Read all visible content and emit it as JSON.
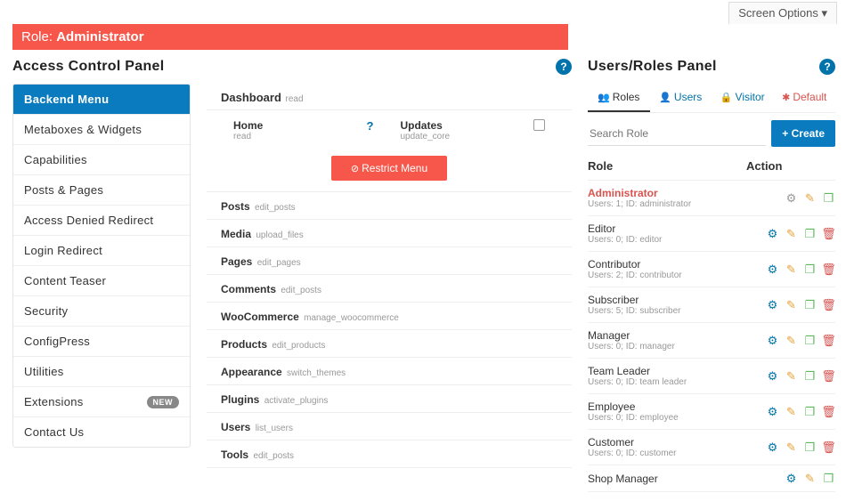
{
  "screen_options": "Screen Options ▾",
  "banner": {
    "prefix": "Role:",
    "role": "Administrator"
  },
  "left_panel_title": "Access Control Panel",
  "right_panel_title": "Users/Roles Panel",
  "sidebar": {
    "items": [
      {
        "label": "Backend Menu",
        "active": true
      },
      {
        "label": "Metaboxes & Widgets"
      },
      {
        "label": "Capabilities"
      },
      {
        "label": "Posts & Pages"
      },
      {
        "label": "Access Denied Redirect"
      },
      {
        "label": "Login Redirect"
      },
      {
        "label": "Content Teaser"
      },
      {
        "label": "Security"
      },
      {
        "label": "ConfigPress"
      },
      {
        "label": "Utilities"
      },
      {
        "label": "Extensions",
        "badge": "NEW"
      },
      {
        "label": "Contact Us"
      }
    ]
  },
  "dashboard": {
    "title": "Dashboard",
    "cap": "read",
    "home": {
      "label": "Home",
      "cap": "read"
    },
    "updates": {
      "label": "Updates",
      "cap": "update_core"
    },
    "restrict_label": "Restrict Menu"
  },
  "menu_caps": [
    {
      "title": "Posts",
      "cap": "edit_posts"
    },
    {
      "title": "Media",
      "cap": "upload_files"
    },
    {
      "title": "Pages",
      "cap": "edit_pages"
    },
    {
      "title": "Comments",
      "cap": "edit_posts"
    },
    {
      "title": "WooCommerce",
      "cap": "manage_woocommerce"
    },
    {
      "title": "Products",
      "cap": "edit_products"
    },
    {
      "title": "Appearance",
      "cap": "switch_themes"
    },
    {
      "title": "Plugins",
      "cap": "activate_plugins"
    },
    {
      "title": "Users",
      "cap": "list_users"
    },
    {
      "title": "Tools",
      "cap": "edit_posts"
    }
  ],
  "tabs": {
    "roles": "Roles",
    "users": "Users",
    "visitor": "Visitor",
    "default": "Default"
  },
  "search_placeholder": "Search Role",
  "create_label": "Create",
  "roles_header": {
    "role": "Role",
    "action": "Action"
  },
  "roles": [
    {
      "name": "Administrator",
      "meta": "Users: 1; ID: administrator",
      "admin": true,
      "gear_muted": true,
      "trash": false
    },
    {
      "name": "Editor",
      "meta": "Users: 0; ID: editor",
      "trash": true
    },
    {
      "name": "Contributor",
      "meta": "Users: 2; ID: contributor",
      "trash": true
    },
    {
      "name": "Subscriber",
      "meta": "Users: 5; ID: subscriber",
      "trash": true
    },
    {
      "name": "Manager",
      "meta": "Users: 0; ID: manager",
      "trash": true
    },
    {
      "name": "Team Leader",
      "meta": "Users: 0; ID: team leader",
      "trash": true
    },
    {
      "name": "Employee",
      "meta": "Users: 0; ID: employee",
      "trash": true
    },
    {
      "name": "Customer",
      "meta": "Users: 0; ID: customer",
      "trash": true
    },
    {
      "name": "Shop Manager",
      "meta": "",
      "trash": false
    }
  ]
}
